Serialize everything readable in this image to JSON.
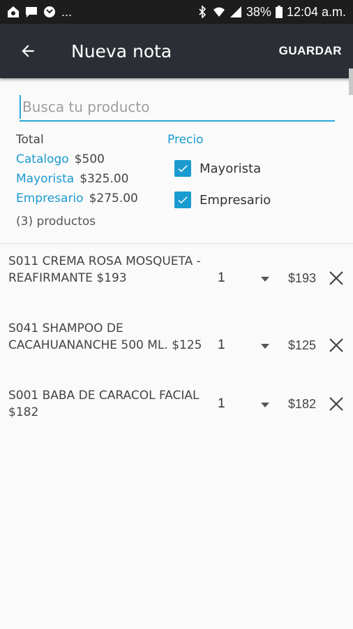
{
  "status_bar": {
    "left_icons": [
      "home-wifi-icon",
      "chat-icon",
      "missed-call-icon"
    ],
    "ellipsis": "...",
    "right_icons": [
      "bluetooth-icon",
      "wifi-icon",
      "signal-icon",
      "battery-icon"
    ],
    "battery": "38%",
    "time": "12:04 a.m."
  },
  "app_bar": {
    "title": "Nueva nota",
    "save_label": "GUARDAR",
    "back_icon": "arrow-back-icon"
  },
  "search": {
    "placeholder": "Busca tu producto",
    "value": ""
  },
  "totals": {
    "total_label": "Total",
    "rows": [
      {
        "label": "Catalogo",
        "amount": "$500"
      },
      {
        "label": "Mayorista",
        "amount": "$325.00"
      },
      {
        "label": "Empresario",
        "amount": "$275.00"
      }
    ],
    "count": "(3) productos"
  },
  "precio": {
    "title": "Precio",
    "options": [
      {
        "label": "Mayorista",
        "checked": true
      },
      {
        "label": "Empresario",
        "checked": true
      }
    ]
  },
  "items": [
    {
      "desc": "S011 CREMA ROSA MOSQUETA - REAFIRMANTE $193",
      "qty": "1",
      "price": "$193"
    },
    {
      "desc": "S041 SHAMPOO DE CACAHUANANCHE 500 ML. $125",
      "qty": "1",
      "price": "$125"
    },
    {
      "desc": "S001 BABA DE CARACOL FACIAL $182",
      "qty": "1",
      "price": "$182"
    }
  ],
  "colors": {
    "accent": "#1a9bd0",
    "app_bar": "#2b2f35",
    "status_bar": "#1d1d1d",
    "background": "#fafafa"
  }
}
